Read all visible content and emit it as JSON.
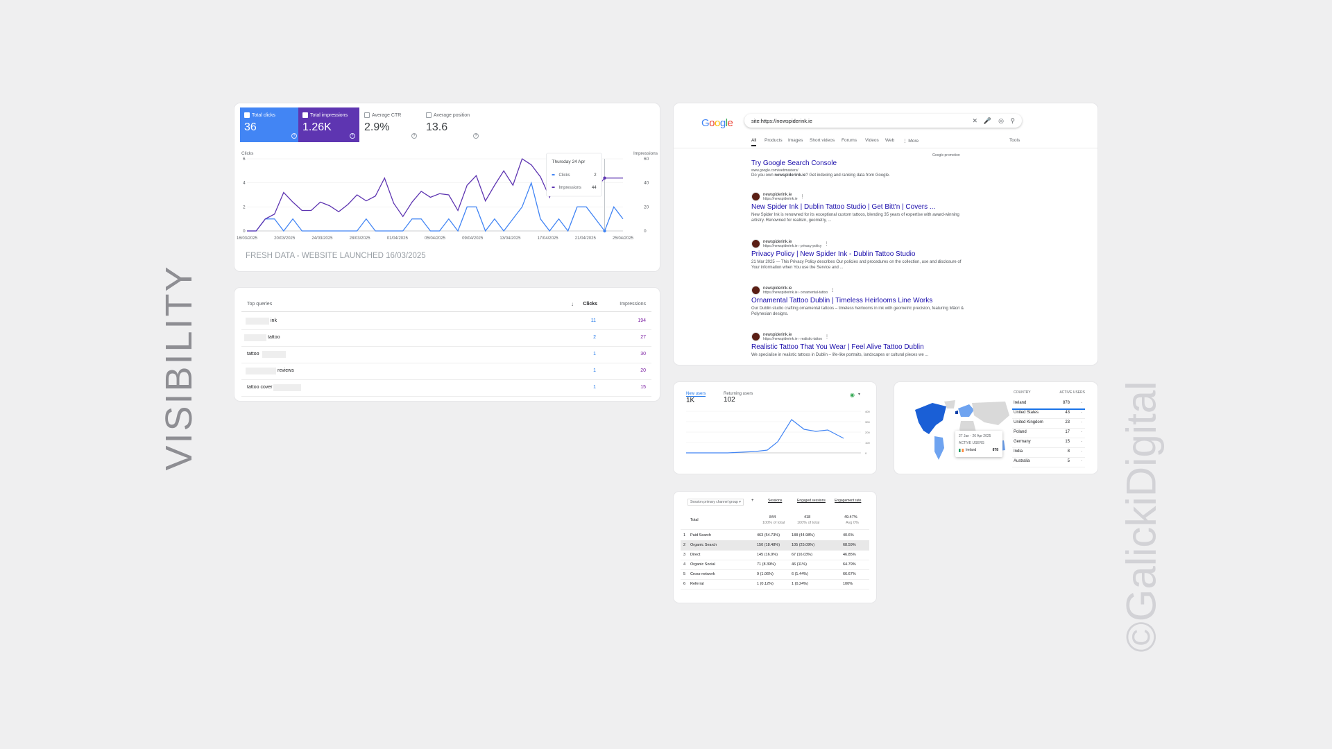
{
  "side_title": "VISIBILITY",
  "watermark": "©GalickiDigital",
  "performance": {
    "metrics": [
      {
        "label": "Total clicks",
        "value": "36",
        "checked": true
      },
      {
        "label": "Total impressions",
        "value": "1.26K",
        "checked": true
      },
      {
        "label": "Average CTR",
        "value": "2.9%",
        "checked": false
      },
      {
        "label": "Average position",
        "value": "13.6",
        "checked": false
      }
    ],
    "left_axis_label": "Clicks",
    "right_axis_label": "Impressions",
    "left_ticks": [
      "6",
      "4",
      "2",
      "0"
    ],
    "right_ticks": [
      "60",
      "40",
      "20",
      "0"
    ],
    "x_ticks": [
      "16/03/2025",
      "20/03/2025",
      "24/03/2025",
      "28/03/2025",
      "01/04/2025",
      "05/04/2025",
      "09/04/2025",
      "13/04/2025",
      "17/04/2025",
      "21/04/2025",
      "25/04/2025"
    ],
    "tooltip": {
      "date": "Thursday 24 Apr",
      "clicks_label": "Clicks",
      "clicks_value": "2",
      "impressions_label": "Impressions",
      "impressions_value": "44"
    },
    "footer_note": "FRESH DATA - WEBSITE LAUNCHED 16/03/2025",
    "colors": {
      "clicks": "#4285f4",
      "impressions": "#5e35b1"
    }
  },
  "chart_data": {
    "type": "line",
    "x": [
      "16/03",
      "17/03",
      "18/03",
      "19/03",
      "20/03",
      "21/03",
      "22/03",
      "23/03",
      "24/03",
      "25/03",
      "26/03",
      "27/03",
      "28/03",
      "29/03",
      "30/03",
      "31/03",
      "01/04",
      "02/04",
      "03/04",
      "04/04",
      "05/04",
      "06/04",
      "07/04",
      "08/04",
      "09/04",
      "10/04",
      "11/04",
      "12/04",
      "13/04",
      "14/04",
      "15/04",
      "16/04",
      "17/04",
      "18/04",
      "19/04",
      "20/04",
      "21/04",
      "22/04",
      "23/04",
      "24/04",
      "25/04",
      "26/04"
    ],
    "series": [
      {
        "name": "Clicks",
        "axis": "left",
        "values": [
          0,
          0,
          1,
          1,
          0,
          1,
          0,
          0,
          0,
          0,
          0,
          0,
          0,
          1,
          0,
          0,
          0,
          0,
          1,
          1,
          0,
          0,
          1,
          0,
          2,
          2,
          0,
          1,
          0,
          1,
          2,
          4,
          1,
          0,
          1,
          0,
          2,
          2,
          1,
          0,
          2,
          1
        ]
      },
      {
        "name": "Impressions",
        "axis": "right",
        "values": [
          0,
          0,
          10,
          14,
          32,
          24,
          17,
          17,
          24,
          21,
          16,
          22,
          30,
          25,
          29,
          44,
          23,
          12,
          24,
          33,
          28,
          31,
          30,
          17,
          38,
          46,
          25,
          38,
          50,
          38,
          60,
          55,
          45,
          28,
          50,
          46,
          55,
          40,
          35,
          44,
          44,
          44
        ]
      }
    ],
    "left_axis": {
      "label": "Clicks",
      "range": [
        0,
        6
      ]
    },
    "right_axis": {
      "label": "Impressions",
      "range": [
        0,
        60
      ]
    }
  },
  "queries": {
    "header": {
      "query": "Top queries",
      "clicks": "Clicks",
      "impressions": "Impressions"
    },
    "rows": [
      {
        "text": "ink",
        "clicks": "11",
        "impressions": "194"
      },
      {
        "text": "tattoo",
        "clicks": "2",
        "impressions": "27"
      },
      {
        "text": "tattoo",
        "clicks": "1",
        "impressions": "30"
      },
      {
        "text": "reviews",
        "clicks": "1",
        "impressions": "20"
      },
      {
        "text": "tattoo cover",
        "clicks": "1",
        "impressions": "15"
      }
    ]
  },
  "serp": {
    "logo": "Google",
    "query": "site:https://newspiderink.ie",
    "tabs": [
      "All",
      "Products",
      "Images",
      "Short videos",
      "Forums",
      "Videos",
      "Web",
      "⋮ More"
    ],
    "tools": "Tools",
    "promo_label": "Google promotion",
    "promo": {
      "title": "Try Google Search Console",
      "url": "www.google.com/webmasters/",
      "snippet_pre": "Do you own ",
      "snippet_bold": "newspiderink.ie",
      "snippet_post": "? Get indexing and ranking data from Google."
    },
    "results": [
      {
        "site": "newspiderink.ie",
        "url": "https://newspiderink.ie",
        "title": "New Spider Ink | Dublin Tattoo Studio | Get Bitt'n | Covers ...",
        "snippet": "New Spider Ink is renowned for its exceptional custom tattoos, blending 35 years of expertise with award-winning artistry. Renowned for realism, geometry, ..."
      },
      {
        "site": "newspiderink.ie",
        "url": "https://newspiderink.ie › privacy-policy",
        "title": "Privacy Policy | New Spider Ink - Dublin Tattoo Studio",
        "snippet": "21 Mar 2025 — This Privacy Policy describes Our policies and procedures on the collection, use and disclosure of Your information when You use the Service and ..."
      },
      {
        "site": "newspiderink.ie",
        "url": "https://newspiderink.ie › ornamental-tattoo",
        "title": "Ornamental Tattoo Dublin | Timeless Heirlooms Line Works",
        "snippet": "Our Dublin studio crafting ornamental tattoos – timeless heirlooms in ink with geometric precision, featuring Māori & Polynesian designs."
      },
      {
        "site": "newspiderink.ie",
        "url": "https://newspiderink.ie › realistic-tattoo",
        "title": "Realistic Tattoo That You Wear | Feel Alive Tattoo Dublin",
        "snippet": "We specialise in realistic tattoos in Dublin – life-like portraits, landscapes or cultural pieces we ..."
      }
    ]
  },
  "ga_users": {
    "new_users_label": "New users",
    "new_users_value": "1K",
    "returning_label": "Returning users",
    "returning_value": "102",
    "y_ticks": [
      "400",
      "300",
      "200",
      "100",
      "0"
    ]
  },
  "geo": {
    "col_country": "COUNTRY",
    "col_users": "ACTIVE USERS",
    "rows": [
      {
        "country": "Ireland",
        "users": "878"
      },
      {
        "country": "United States",
        "users": "43"
      },
      {
        "country": "United Kingdom",
        "users": "23"
      },
      {
        "country": "Poland",
        "users": "17"
      },
      {
        "country": "Germany",
        "users": "15"
      },
      {
        "country": "India",
        "users": "8"
      },
      {
        "country": "Australia",
        "users": "5"
      }
    ],
    "tooltip": {
      "range": "27 Jan - 26 Apr 2025",
      "label": "ACTIVE USERS",
      "country": "Ireland",
      "value": "878"
    },
    "colors": {
      "high": "#1a5fd6",
      "mid": "#6ea3f0",
      "none": "#d9d9d9"
    }
  },
  "channels": {
    "dimension": "Session primary channel group",
    "cols": [
      "Sessions",
      "Engaged sessions",
      "Engagement rate"
    ],
    "total": {
      "label": "Total",
      "sessions": "844",
      "sessions_sub": "100% of total",
      "engaged": "418",
      "engaged_sub": "100% of total",
      "rate": "49.47%",
      "rate_sub": "Avg 0%"
    },
    "rows": [
      {
        "n": "1",
        "name": "Paid Search",
        "sessions": "463 (54.73%)",
        "engaged": "188 (44.98%)",
        "rate": "40.6%"
      },
      {
        "n": "2",
        "name": "Organic Search",
        "sessions": "150 (18.48%)",
        "engaged": "105 (25.09%)",
        "rate": "68.59%"
      },
      {
        "n": "3",
        "name": "Direct",
        "sessions": "145 (16.9%)",
        "engaged": "67 (16.03%)",
        "rate": "46.85%"
      },
      {
        "n": "4",
        "name": "Organic Social",
        "sessions": "71 (8.39%)",
        "engaged": "46 (11%)",
        "rate": "64.79%"
      },
      {
        "n": "5",
        "name": "Cross-network",
        "sessions": "9 (1.06%)",
        "engaged": "6 (1.44%)",
        "rate": "66.67%"
      },
      {
        "n": "6",
        "name": "Referral",
        "sessions": "1 (0.12%)",
        "engaged": "1 (0.24%)",
        "rate": "100%"
      }
    ]
  }
}
